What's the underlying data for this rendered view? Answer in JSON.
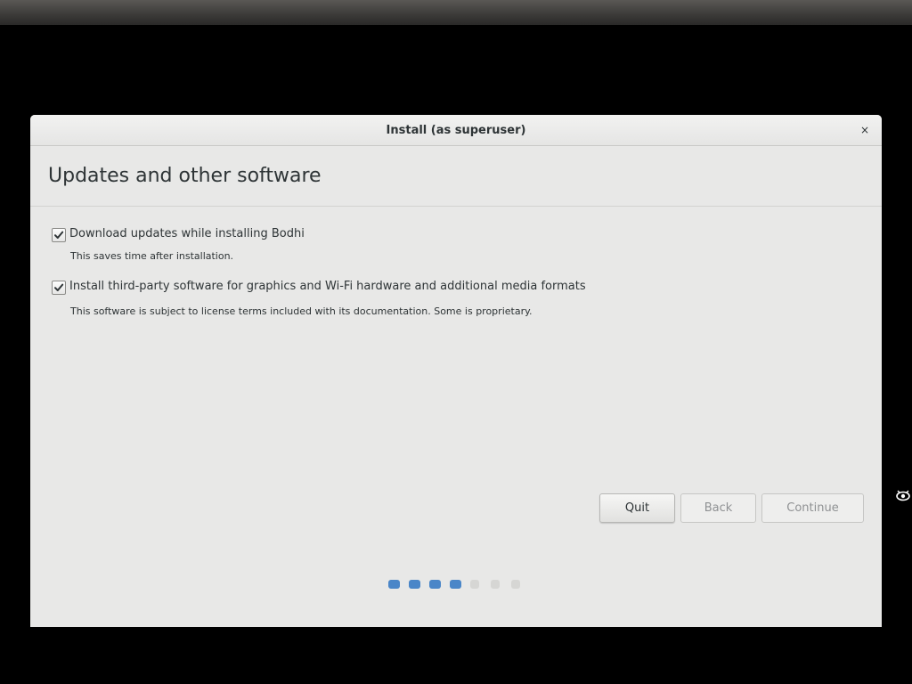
{
  "window": {
    "title": "Install (as superuser)",
    "close_symbol": "×"
  },
  "page": {
    "title": "Updates and other software"
  },
  "options": [
    {
      "label": "Download updates while installing Bodhi",
      "description": "This saves time after installation.",
      "checked": true
    },
    {
      "label": "Install third-party software for graphics and Wi-Fi hardware and additional media formats",
      "description": "This software is subject to license terms included with its documentation. Some is proprietary.",
      "checked": true
    }
  ],
  "buttons": {
    "quit": "Quit",
    "back": "Back",
    "continue": "Continue"
  },
  "progress": {
    "total_steps": 7,
    "completed_steps": 4,
    "active_color": "#4a86c8",
    "inactive_color": "#d6d6d4"
  },
  "icons": {
    "close": "close-icon",
    "checkmark": "checkmark-icon",
    "side": "eye-icon"
  }
}
